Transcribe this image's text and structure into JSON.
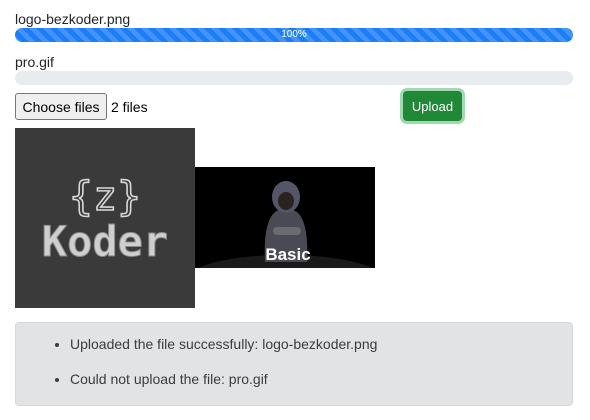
{
  "uploads": [
    {
      "file_name": "logo-bezkoder.png",
      "progress": 100,
      "progress_label": "100%"
    },
    {
      "file_name": "pro.gif",
      "progress": 0,
      "progress_label": ""
    }
  ],
  "file_input": {
    "button_label": "Choose files",
    "status": "2 files"
  },
  "upload_button": {
    "label": "Upload"
  },
  "previews": [
    {
      "alt": "logo-bezkoder.png",
      "lines": [
        "{z}",
        "Koder"
      ]
    },
    {
      "alt": "pro.gif",
      "caption": "Basic"
    }
  ],
  "messages": [
    "Uploaded the file successfully: logo-bezkoder.png",
    "Could not upload the file: pro.gif"
  ],
  "colors": {
    "progress_fill": "#1b7df7",
    "progress_track": "#e9ecef",
    "upload_button": "#218838",
    "message_box_bg": "#e2e3e5"
  }
}
